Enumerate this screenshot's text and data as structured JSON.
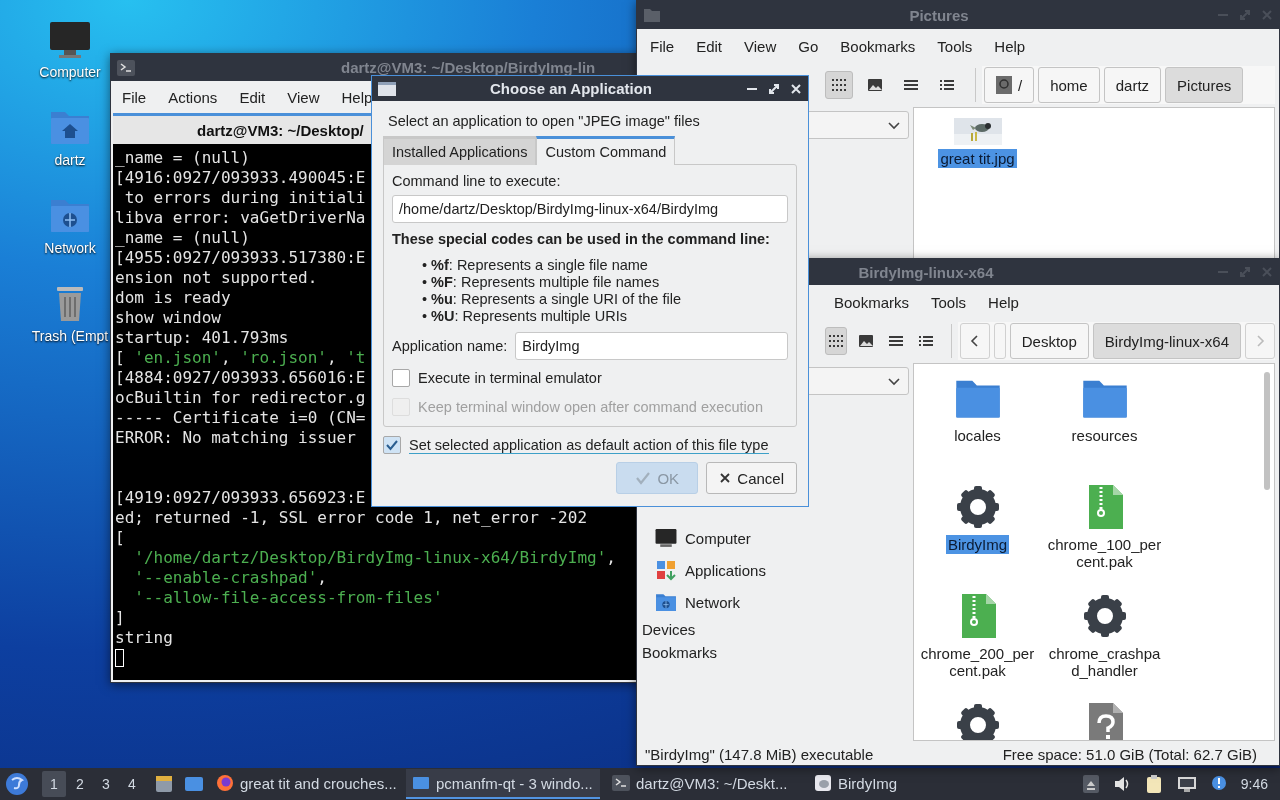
{
  "desktop_icons": [
    {
      "label": "Computer",
      "kind": "computer"
    },
    {
      "label": "dartz",
      "kind": "home"
    },
    {
      "label": "Network",
      "kind": "network"
    },
    {
      "label": "Trash (Empt",
      "kind": "trash"
    }
  ],
  "terminal": {
    "title": "dartz@VM3: ~/Desktop/BirdyImg-lin",
    "menu": [
      "File",
      "Actions",
      "Edit",
      "View",
      "Help"
    ],
    "tab": "dartz@VM3: ~/Desktop/",
    "cursor_visible": true,
    "blocks": [
      {
        "lines": [
          [
            {
              "text": "_name = (null)",
              "kind": "plain"
            }
          ],
          [
            {
              "text": "[4916:0927/093933.490045:E",
              "kind": "plain"
            }
          ],
          [
            {
              "text": " to errors during initiali",
              "kind": "plain"
            }
          ],
          [
            {
              "text": "libva error: vaGetDriverNa",
              "kind": "plain"
            }
          ],
          [
            {
              "text": "_name = (null)",
              "kind": "plain"
            }
          ],
          [
            {
              "text": "[4955:0927/093933.517380:E",
              "kind": "plain"
            }
          ],
          [
            {
              "text": "ension not supported.",
              "kind": "plain"
            }
          ],
          [
            {
              "text": "dom is ready",
              "kind": "plain"
            }
          ],
          [
            {
              "text": "show window",
              "kind": "plain"
            }
          ],
          [
            {
              "text": "startup: 401.793ms",
              "kind": "plain"
            }
          ],
          [
            {
              "text": "[ ",
              "kind": "plain"
            },
            {
              "text": "'en.json'",
              "kind": "string"
            },
            {
              "text": ", ",
              "kind": "plain"
            },
            {
              "text": "'ro.json'",
              "kind": "string"
            },
            {
              "text": ", ",
              "kind": "plain"
            },
            {
              "text": "'t",
              "kind": "string"
            }
          ],
          [
            {
              "text": "[4884:0927/093933.656016:E",
              "kind": "plain"
            }
          ],
          [
            {
              "text": "ocBuiltin for redirector.g",
              "kind": "plain"
            }
          ],
          [
            {
              "text": "----- Certificate i=0 (CN=",
              "kind": "plain"
            }
          ],
          [
            {
              "text": "ERROR: No matching issuer",
              "kind": "plain"
            }
          ]
        ]
      },
      {
        "lines": [
          [
            {
              "text": "[4919:0927/093933.656923:E",
              "kind": "plain"
            }
          ],
          [
            {
              "text": "ed; returned -1, SSL error code 1, net_error -202",
              "kind": "plain"
            }
          ],
          [
            {
              "text": "[",
              "kind": "plain"
            }
          ],
          [
            {
              "text": "  '/home/dartz/Desktop/BirdyImg-linux-x64/BirdyImg'",
              "kind": "string"
            },
            {
              "text": ",",
              "kind": "plain"
            }
          ],
          [
            {
              "text": "  '--enable-crashpad'",
              "kind": "string"
            },
            {
              "text": ",",
              "kind": "plain"
            }
          ],
          [
            {
              "text": "  '--allow-file-access-from-files'",
              "kind": "string"
            }
          ],
          [
            {
              "text": "]",
              "kind": "plain"
            }
          ],
          [
            {
              "text": "string",
              "kind": "plain"
            }
          ]
        ]
      }
    ]
  },
  "pictures_window": {
    "title": "Pictures",
    "menu": [
      "File",
      "Edit",
      "View",
      "Go",
      "Bookmarks",
      "Tools",
      "Help"
    ],
    "view_modes": [
      {
        "kind": "icons",
        "selected": true
      },
      {
        "kind": "thumbnails",
        "selected": false
      },
      {
        "kind": "compact",
        "selected": false
      },
      {
        "kind": "details",
        "selected": false
      }
    ],
    "path": [
      {
        "label": "/",
        "kind": "root",
        "selected": false
      },
      {
        "label": "home",
        "kind": "folder",
        "selected": false
      },
      {
        "label": "dartz",
        "kind": "folder",
        "selected": false
      },
      {
        "label": "Pictures",
        "kind": "folder",
        "selected": true
      }
    ],
    "files": [
      {
        "name": "great tit.jpg",
        "kind": "picture",
        "selected": true
      }
    ]
  },
  "birdy_window": {
    "title": "BirdyImg-linux-x64",
    "menu": [
      "Bookmarks",
      "Tools",
      "Help"
    ],
    "view_modes": [
      {
        "kind": "icons",
        "selected": true
      },
      {
        "kind": "thumbnails",
        "selected": false
      },
      {
        "kind": "compact",
        "selected": false
      },
      {
        "kind": "details",
        "selected": false
      }
    ],
    "path": [
      {
        "label": "Desktop",
        "kind": "folder",
        "selected": false
      },
      {
        "label": "BirdyImg-linux-x64",
        "kind": "folder",
        "selected": true
      }
    ],
    "places": [
      {
        "label": "Computer",
        "kind": "computer"
      },
      {
        "label": "Applications",
        "kind": "apps"
      },
      {
        "label": "Network",
        "kind": "network"
      }
    ],
    "sections": [
      "Devices",
      "Bookmarks"
    ],
    "files": [
      {
        "name": "locales",
        "kind": "folder",
        "selected": false
      },
      {
        "name": "resources",
        "kind": "folder",
        "selected": false
      },
      {
        "name": "BirdyImg",
        "kind": "executable",
        "selected": true
      },
      {
        "name": "chrome_100_percent.pak",
        "kind": "archive",
        "selected": false
      },
      {
        "name": "chrome_200_percent.pak",
        "kind": "archive",
        "selected": false
      },
      {
        "name": "chrome_crashpad_handler",
        "kind": "executable",
        "selected": false
      },
      {
        "kind": "executable",
        "selected": false
      },
      {
        "kind": "unknown",
        "selected": false
      }
    ],
    "status_left": "\"BirdyImg\" (147.8 MiB) executable",
    "status_right": "Free space: 51.0 GiB (Total: 62.7 GiB)"
  },
  "dialog": {
    "title": "Choose an Application",
    "prompt": "Select an application to open \"JPEG image\" files",
    "tabs": [
      {
        "label": "Installed Applications",
        "selected": false
      },
      {
        "label": "Custom Command",
        "selected": true
      }
    ],
    "command_label": "Command line to execute:",
    "command_value": "/home/dartz/Desktop/BirdyImg-linux-x64/BirdyImg",
    "codes_heading": "These special codes can be used in the command line:",
    "codes": [
      "• **%f**: Represents a single file name",
      "• **%F**: Represents multiple file names",
      "• **%u**: Represents a single URI of the file",
      "• **%U**: Represents multiple URIs"
    ],
    "name_label": "Application name:",
    "name_value": "BirdyImg",
    "options": [
      {
        "label": "Execute in terminal emulator",
        "checked": false,
        "disabled": false
      },
      {
        "label": "Keep terminal window open after command execution",
        "checked": false,
        "disabled": true
      }
    ],
    "default_option": {
      "label": "Set selected application as default action of this file type",
      "checked": true
    },
    "buttons": [
      {
        "label": "OK",
        "kind": "ok",
        "disabled": true
      },
      {
        "label": "Cancel",
        "kind": "cancel",
        "disabled": false
      }
    ]
  },
  "taskbar": {
    "workspaces": [
      {
        "label": "1",
        "selected": true
      },
      {
        "label": "2",
        "selected": false
      },
      {
        "label": "3",
        "selected": false
      },
      {
        "label": "4",
        "selected": false
      }
    ],
    "tasks": [
      {
        "label": "great tit and crouches...",
        "kind": "browser",
        "selected": false
      },
      {
        "label": "pcmanfm-qt - 3 windo...",
        "kind": "files",
        "selected": true
      },
      {
        "label": "dartz@VM3: ~/Deskt...",
        "kind": "terminal",
        "selected": false
      },
      {
        "label": "BirdyImg",
        "kind": "app",
        "selected": false
      }
    ],
    "clock": "9:46"
  }
}
